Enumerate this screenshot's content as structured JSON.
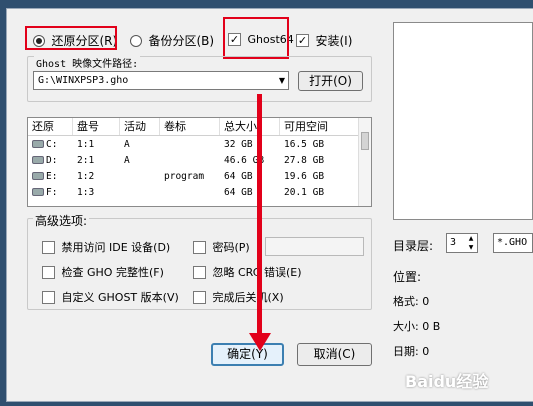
{
  "mode": {
    "restore_label": "还原分区(R)",
    "backup_label": "备份分区(B)",
    "ghost64_label": "Ghost64",
    "install_label": "安装(I)"
  },
  "image_path": {
    "label": "Ghost 映像文件路径:",
    "value": "G:\\WINXPSP3.gho",
    "open_button": "打开(O)"
  },
  "partition_table": {
    "columns": [
      "还原",
      "盘号",
      "活动",
      "卷标",
      "总大小",
      "可用空间"
    ],
    "rows": [
      {
        "drive": "C:",
        "disk": "1:1",
        "active": "A",
        "label": "",
        "total": "32 GB",
        "free": "16.5 GB"
      },
      {
        "drive": "D:",
        "disk": "2:1",
        "active": "A",
        "label": "",
        "total": "46.6 GB",
        "free": "27.8 GB"
      },
      {
        "drive": "E:",
        "disk": "1:2",
        "active": "",
        "label": "program",
        "total": "64 GB",
        "free": "19.6 GB"
      },
      {
        "drive": "F:",
        "disk": "1:3",
        "active": "",
        "label": "",
        "total": "64 GB",
        "free": "20.1 GB"
      }
    ]
  },
  "advanced": {
    "title": "高级选项:",
    "ban_ide": "禁用访问 IDE 设备(D)",
    "password": "密码(P)",
    "check_gho": "检查 GHO 完整性(F)",
    "ignore_crc": "忽略 CRC 错误(E)",
    "custom_ghost": "自定义 GHOST 版本(V)",
    "shutdown": "完成后关机(X)"
  },
  "right_panel": {
    "dir_level_label": "目录层:",
    "dir_level_value": "3",
    "filter_value": "*.GHO",
    "position_label": "位置:",
    "format_label": "格式: 0",
    "size_label": "大小: 0 B",
    "date_label": "日期: 0"
  },
  "buttons": {
    "ok": "确定(Y)",
    "cancel": "取消(C)"
  },
  "watermark": "Baidu经验"
}
